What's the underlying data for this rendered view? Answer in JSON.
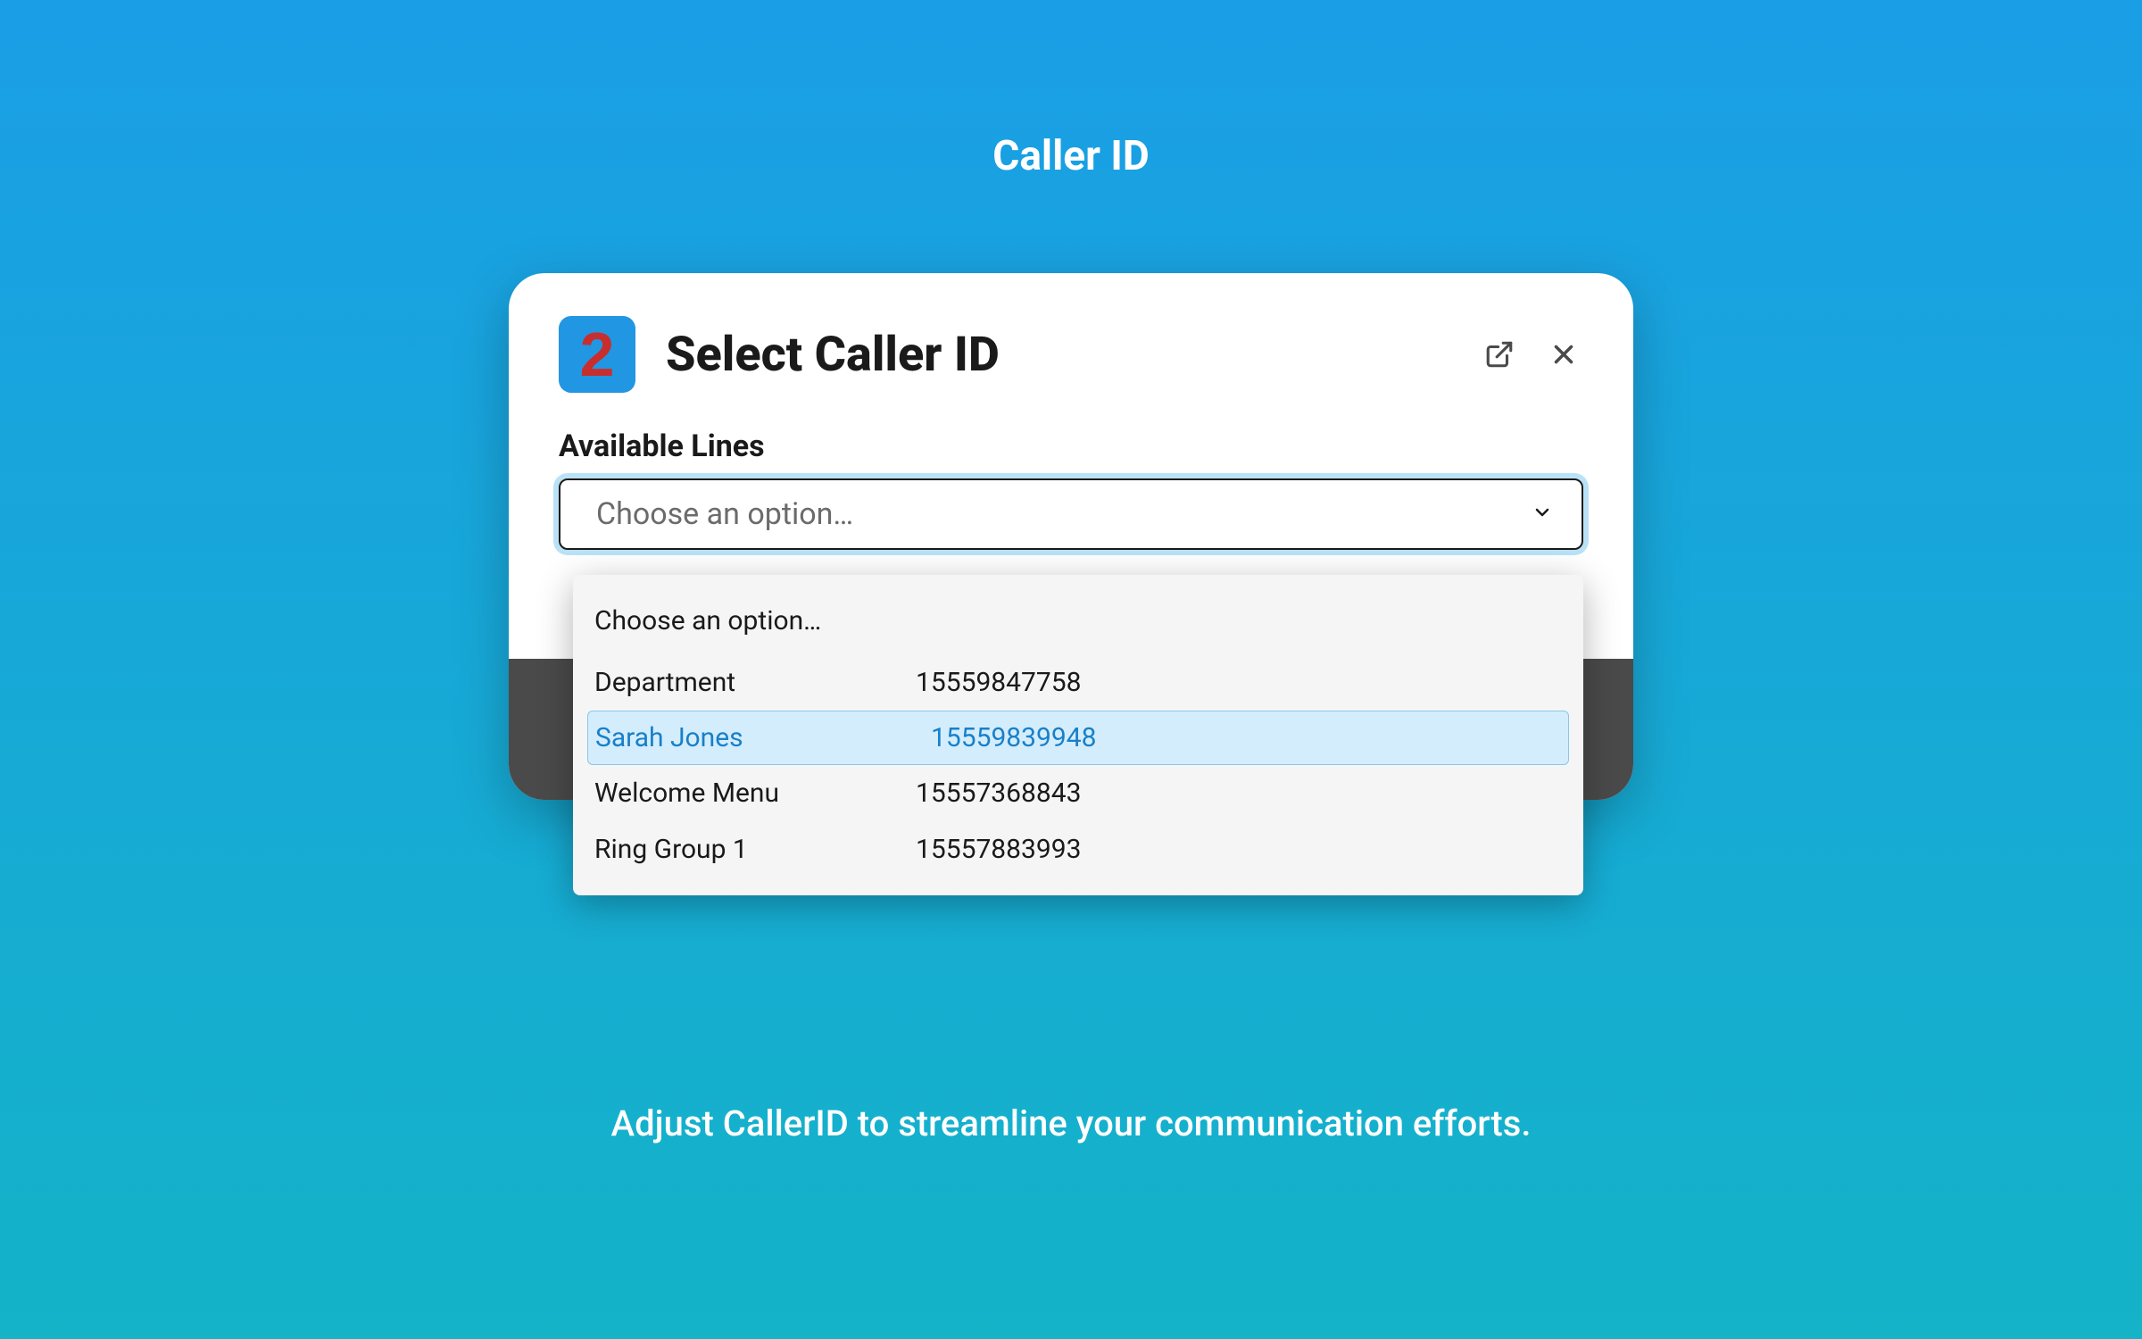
{
  "page": {
    "title": "Caller ID",
    "footer_text": "Adjust CallerID to streamline your communication efforts."
  },
  "modal": {
    "logo_text": "2",
    "title": "Select Caller ID",
    "section_label": "Available Lines",
    "select_placeholder": "Choose an option…"
  },
  "dropdown": {
    "placeholder": "Choose an option…",
    "options": [
      {
        "name": "Department",
        "number": "15559847758",
        "highlighted": false
      },
      {
        "name": "Sarah Jones",
        "number": "15559839948",
        "highlighted": true
      },
      {
        "name": "Welcome Menu",
        "number": "15557368843",
        "highlighted": false
      },
      {
        "name": "Ring Group 1",
        "number": "15557883993",
        "highlighted": false
      }
    ]
  }
}
